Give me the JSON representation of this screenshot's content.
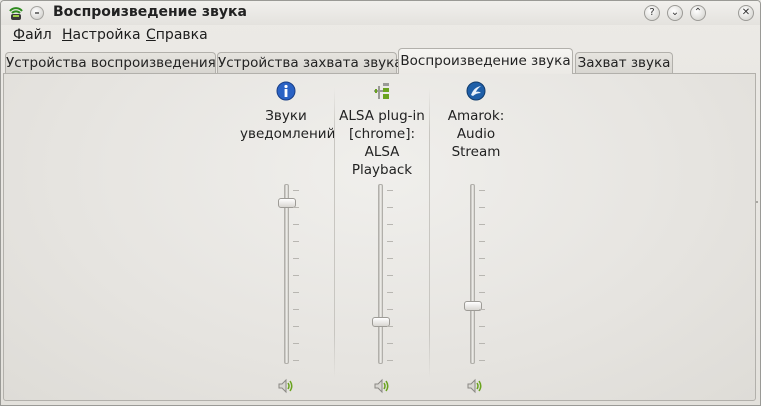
{
  "window": {
    "title": "Воспроизведение звука"
  },
  "titlebar": {
    "help": "?",
    "minimize": "⌄",
    "maximize": "⌃",
    "close": "✕"
  },
  "menu": [
    {
      "first": "Ф",
      "rest": "айл"
    },
    {
      "first": "Н",
      "rest": "астройка"
    },
    {
      "first": "С",
      "rest": "правка"
    }
  ],
  "tabs": [
    {
      "label": "Устройства воспроизведения",
      "active": false
    },
    {
      "label": "Устройства захвата звука",
      "active": false
    },
    {
      "label": "Воспроизведение звука",
      "active": true
    },
    {
      "label": "Захват звука",
      "active": false
    }
  ],
  "channels": [
    {
      "icon": "info-icon",
      "label_lines": [
        "Звуки",
        "уведомлений"
      ],
      "volume_fraction": 0.92,
      "mute": "speaker-icon"
    },
    {
      "icon": "plugin-icon",
      "label_lines": [
        "ALSA plug-in",
        "[chrome]:",
        "ALSA",
        "Playback"
      ],
      "volume_fraction": 0.22,
      "mute": "speaker-icon"
    },
    {
      "icon": "amarok-icon",
      "label_lines": [
        "Amarok:",
        "Audio",
        "Stream"
      ],
      "volume_fraction": 0.31,
      "mute": "speaker-icon"
    }
  ],
  "colors": {
    "accent_green": "#6aa31f",
    "info_blue": "#2a62c4",
    "amarok_blue": "#1f5fa8"
  }
}
